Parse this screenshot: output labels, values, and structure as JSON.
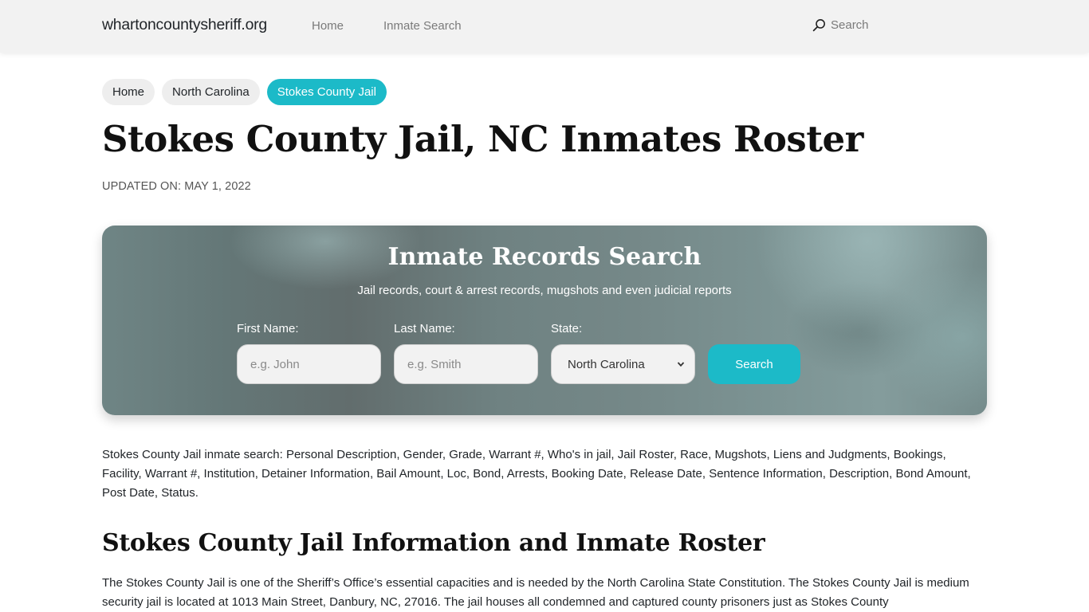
{
  "navbar": {
    "brand": "whartoncountysheriff.org",
    "links": [
      {
        "label": "Home"
      },
      {
        "label": "Inmate Search"
      }
    ],
    "search_label": "Search",
    "search_icon": "search-icon"
  },
  "breadcrumb": [
    {
      "label": "Home",
      "active": false
    },
    {
      "label": "North Carolina",
      "active": false
    },
    {
      "label": "Stokes County Jail",
      "active": true
    }
  ],
  "page": {
    "title": "Stokes County Jail, NC Inmates Roster",
    "updated": "UPDATED ON: MAY 1, 2022"
  },
  "search_card": {
    "title": "Inmate Records Search",
    "subtitle": "Jail records, court & arrest records, mugshots and even judicial reports",
    "first_name": {
      "label": "First Name:",
      "placeholder": "e.g. John",
      "value": ""
    },
    "last_name": {
      "label": "Last Name:",
      "placeholder": "e.g. Smith",
      "value": ""
    },
    "state": {
      "label": "State:",
      "selected": "North Carolina"
    },
    "button_label": "Search"
  },
  "intro_text": "Stokes County Jail inmate search: Personal Description, Gender, Grade, Warrant #, Who's in jail, Jail Roster, Race, Mugshots, Liens and Judgments, Bookings, Facility, Warrant #, Institution, Detainer Information, Bail Amount, Loc, Bond, Arrests, Booking Date, Release Date, Sentence Information, Description, Bond Amount, Post Date, Status.",
  "section": {
    "title": "Stokes County Jail Information and Inmate Roster",
    "body": "The Stokes County Jail is one of the Sheriff’s Office’s essential capacities and is needed by the North Carolina State Constitution. The Stokes County Jail is medium security jail is located at 1013 Main Street, Danbury, NC, 27016. The jail houses all condemned and captured county prisoners just as Stokes County"
  },
  "colors": {
    "accent": "#1cbac8",
    "navbar_bg": "#f2f2f2",
    "crumb_bg": "#eeeeee"
  }
}
